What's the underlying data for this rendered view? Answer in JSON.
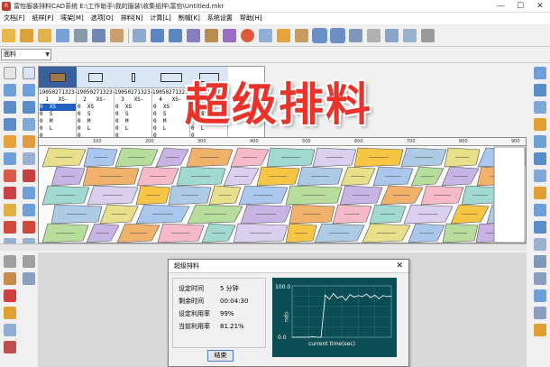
{
  "window": {
    "title": "富怡服装排料CAD系统  E:\\工作助手\\我的服装\\收集纸样\\富怡\\Untitled.mkr"
  },
  "menu": [
    "文档[F]",
    "纸样[P]",
    "唛架[M]",
    "选项[O]",
    "排料[N]",
    "计算[L]",
    "制帽[K]",
    "系统设置",
    "帮助[H]"
  ],
  "material_combo": {
    "value": "面料"
  },
  "pieces": [
    {
      "code": "19050271323-",
      "index": "1",
      "label": "XS-"
    },
    {
      "code": "19050271323-",
      "index": "2",
      "label": "XS-"
    },
    {
      "code": "19050271323-",
      "index": "3",
      "label": "XS-"
    },
    {
      "code": "19050271323-",
      "index": "4",
      "label": "XS-"
    },
    {
      "code": "19050271323-",
      "index": "5",
      "label": "XS-"
    }
  ],
  "size_rows": [
    {
      "n": "0",
      "s": "XS"
    },
    {
      "n": "0",
      "s": "S"
    },
    {
      "n": "0",
      "s": "M"
    },
    {
      "n": "0",
      "s": "L"
    },
    {
      "n": "0",
      "s": ""
    }
  ],
  "ruler_ticks": [
    "100",
    "200",
    "300",
    "400",
    "500",
    "600",
    "700",
    "800",
    "900"
  ],
  "overlay_title": "超级排料",
  "dialog": {
    "title": "超级排料",
    "stats": [
      {
        "label": "设定时间",
        "value": "5 分钟"
      },
      {
        "label": "剩余时间",
        "value": "00:04:30"
      },
      {
        "label": "设定利用率",
        "value": "99%"
      },
      {
        "label": "当前利用率",
        "value": "81.21%"
      }
    ],
    "finish_label": "结束",
    "chart": {
      "y_top": "100.0",
      "y_bottom": "0.0",
      "y_axis": "cpu",
      "x_axis": "current time(sec)"
    }
  },
  "chart_data": {
    "type": "line",
    "ylim": [
      0,
      100
    ],
    "values": [
      0,
      0,
      0,
      0,
      0,
      1,
      0,
      0,
      82,
      74,
      85,
      76,
      80,
      72,
      83,
      78,
      81,
      79,
      84,
      77,
      82,
      75,
      81,
      79,
      80
    ]
  },
  "colors": {
    "accent": "#e8322a",
    "chart_bg": "#0b4d55",
    "chart_line": "#ffffff"
  }
}
